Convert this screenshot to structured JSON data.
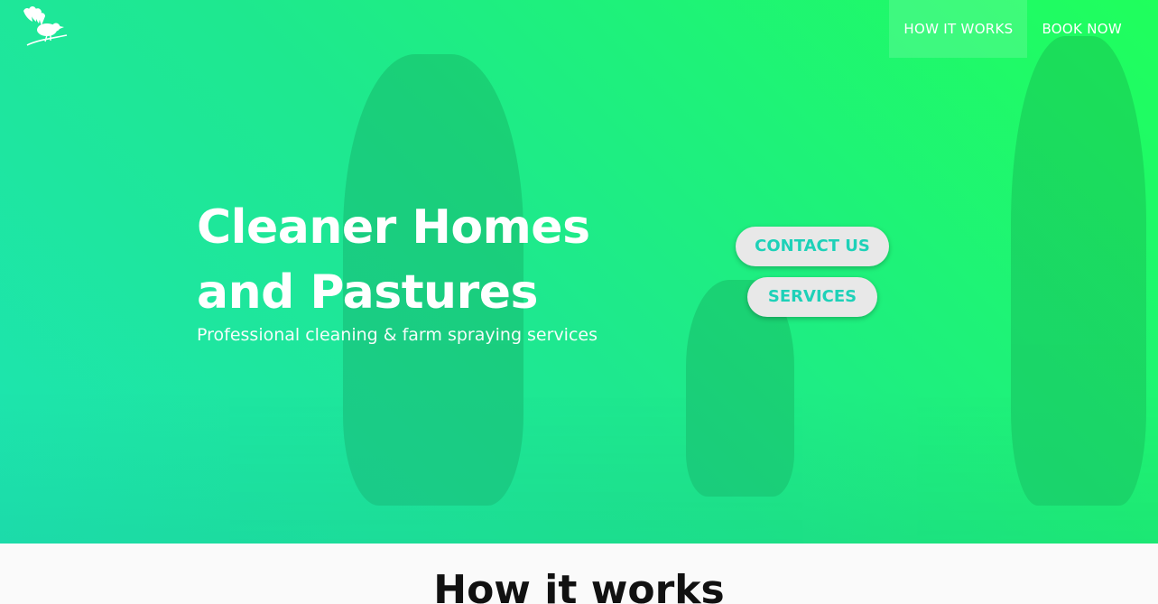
{
  "brand": {
    "logo_icon": "fantail-bird-icon"
  },
  "nav": {
    "items": [
      {
        "label": "HOW IT WORKS",
        "active": true
      },
      {
        "label": "BOOK NOW",
        "active": false
      }
    ]
  },
  "hero": {
    "title": "Cleaner Homes and Pastures",
    "subtitle": "Professional cleaning & farm spraying services",
    "contact_label": "CONTACT US",
    "services_label": "SERVICES"
  },
  "how_it_works": {
    "title": "How it works"
  },
  "colors": {
    "gradient_start": "#1de4b3",
    "gradient_end": "#1fff5c",
    "button_bg": "#e8e8e8",
    "button_text": "#1ed1b8"
  }
}
